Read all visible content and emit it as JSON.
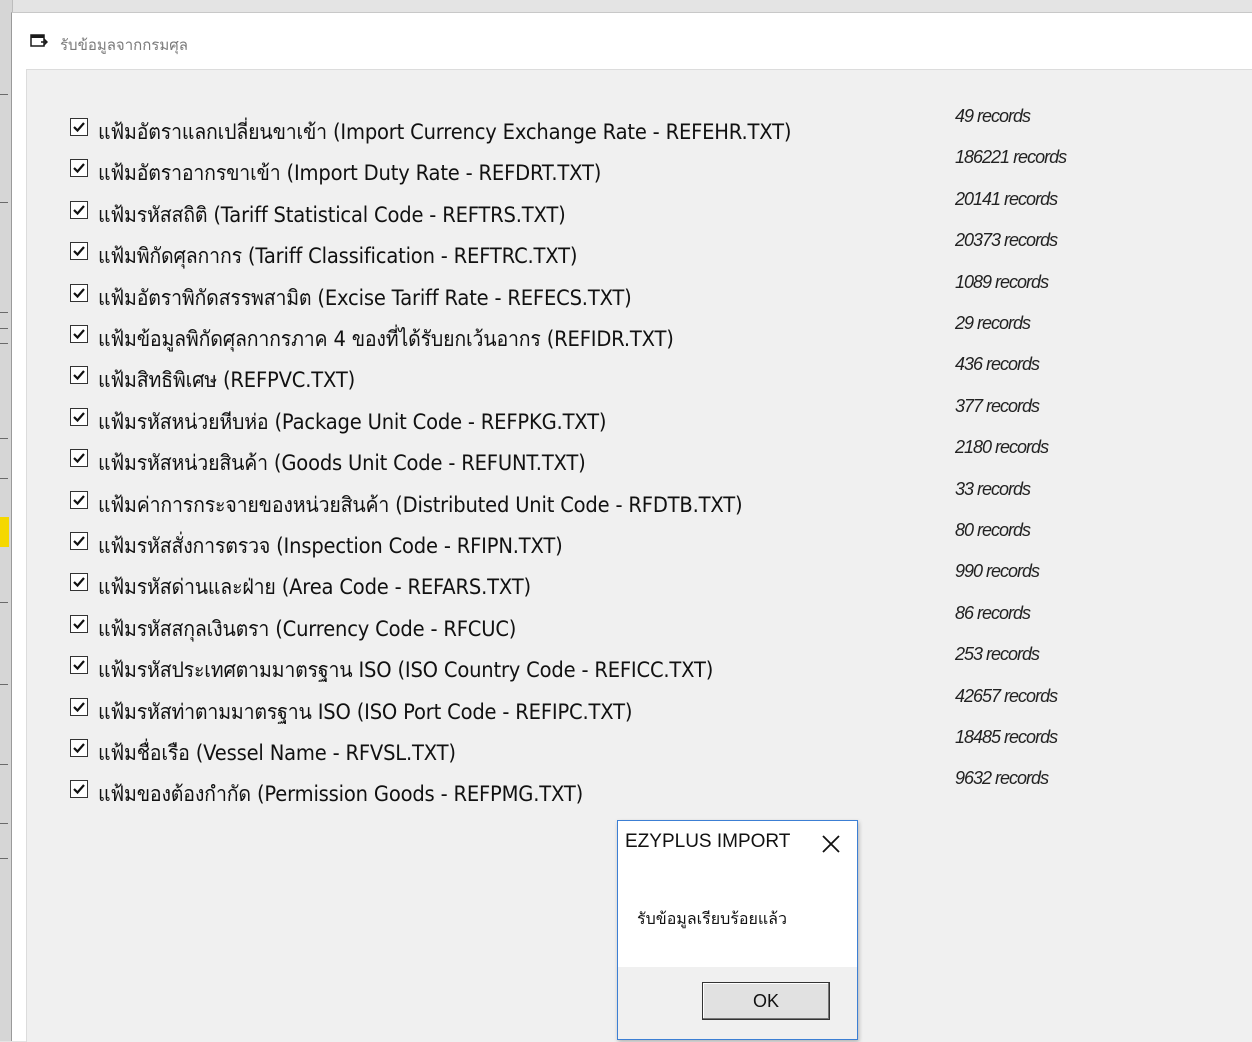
{
  "window": {
    "title": "รับข้อมูลจากกรมศุล"
  },
  "items": [
    {
      "label": "แฟ้มอัตราแลกเปลี่ยนขาเข้า (Import Currency Exchange Rate - REFEHR.TXT)",
      "count": "49 records",
      "checked": true
    },
    {
      "label": "แฟ้มอัตราอากรขาเข้า (Import Duty Rate - REFDRT.TXT)",
      "count": "186221 records",
      "checked": true
    },
    {
      "label": "แฟ้มรหัสสถิติ (Tariff Statistical Code - REFTRS.TXT)",
      "count": "20141 records",
      "checked": true
    },
    {
      "label": "แฟ้มพิกัดศุลกากร (Tariff Classification - REFTRC.TXT)",
      "count": "20373 records",
      "checked": true
    },
    {
      "label": "แฟ้มอัตราพิกัดสรรพสามิต (Excise Tariff Rate - REFECS.TXT)",
      "count": "1089 records",
      "checked": true
    },
    {
      "label": "แฟ้มข้อมูลพิกัดศุลกากรภาค 4 ของที่ได้รับยกเว้นอากร (REFIDR.TXT)",
      "count": "29 records",
      "checked": true
    },
    {
      "label": "แฟ้มสิทธิพิเศษ (REFPVC.TXT)",
      "count": "436 records",
      "checked": true
    },
    {
      "label": "แฟ้มรหัสหน่วยหีบห่อ (Package Unit Code - REFPKG.TXT)",
      "count": "377 records",
      "checked": true
    },
    {
      "label": "แฟ้มรหัสหน่วยสินค้า (Goods Unit Code - REFUNT.TXT)",
      "count": "2180 records",
      "checked": true
    },
    {
      "label": "แฟ้มค่าการกระจายของหน่วยสินค้า (Distributed Unit Code - RFDTB.TXT)",
      "count": "33 records",
      "checked": true
    },
    {
      "label": "แฟ้มรหัสสั่งการตรวจ (Inspection Code - RFIPN.TXT)",
      "count": "80 records",
      "checked": true
    },
    {
      "label": "แฟ้มรหัสด่านและฝ่าย (Area Code - REFARS.TXT)",
      "count": "990 records",
      "checked": true
    },
    {
      "label": "แฟ้มรหัสสกุลเงินตรา (Currency Code - RFCUC)",
      "count": "86 records",
      "checked": true
    },
    {
      "label": "แฟ้มรหัสประเทศตามมาตรฐาน ISO (ISO Country Code - REFICC.TXT)",
      "count": "253 records",
      "checked": true
    },
    {
      "label": "แฟ้มรหัสท่าตามมาตรฐาน ISO (ISO Port Code - REFIPC.TXT)",
      "count": "42657 records",
      "checked": true
    },
    {
      "label": "แฟ้มชื่อเรือ (Vessel Name - RFVSL.TXT)",
      "count": "18485 records",
      "checked": true
    },
    {
      "label": "แฟ้มของต้องกำกัด (Permission Goods - REFPMG.TXT)",
      "count": "9632 records",
      "checked": true
    }
  ],
  "dialog": {
    "title": "EZYPLUS IMPORT",
    "message": "รับข้อมูลเรียบร้อยแล้ว",
    "ok_label": "OK"
  }
}
